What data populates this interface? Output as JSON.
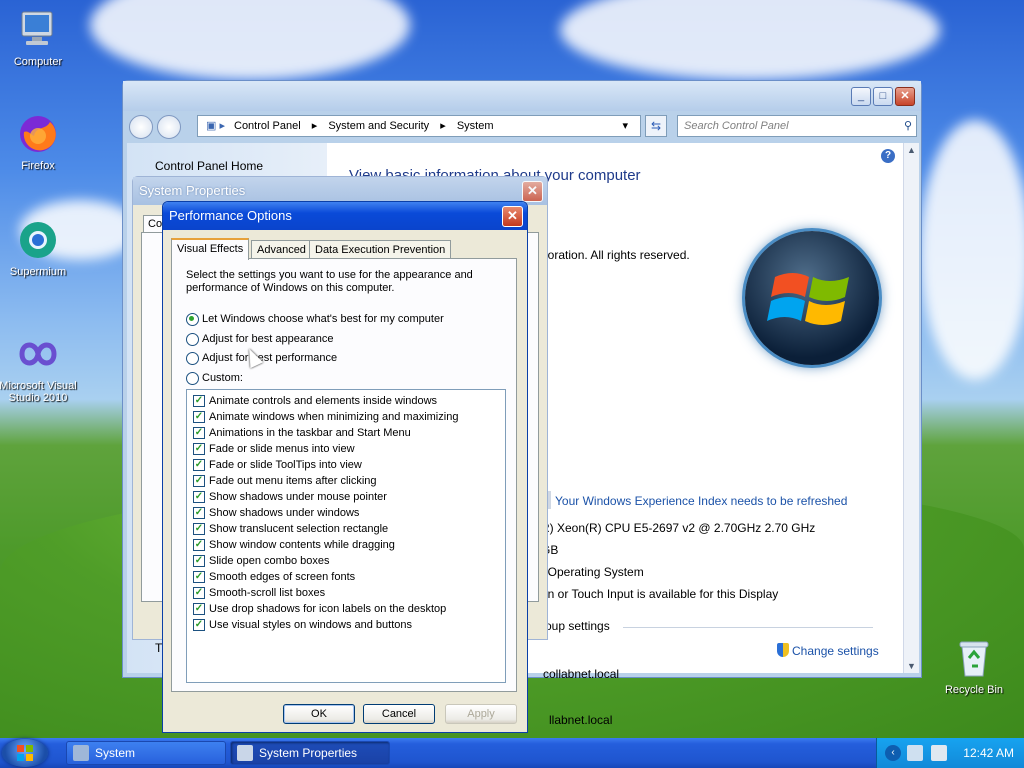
{
  "desktop": {
    "icons": [
      {
        "label": "Computer"
      },
      {
        "label": "Firefox"
      },
      {
        "label": "Supermium"
      },
      {
        "label": "Microsoft Visual Studio 2010"
      },
      {
        "label": "Recycle Bin"
      }
    ]
  },
  "control_panel": {
    "breadcrumb": [
      "Control Panel",
      "System and Security",
      "System"
    ],
    "search_placeholder": "Search Control Panel",
    "left_pane": {
      "home_link": "Control Panel Home"
    },
    "heading": "View basic information about your computer",
    "copyright_fragment": "poration.  All rights reserved.",
    "wei_link": "Your Windows Experience Index needs to be refreshed",
    "processor_fragment": "R) Xeon(R) CPU E5-2697 v2 @ 2.70GHz   2.70 GHz",
    "ram_fragment": "GB",
    "system_type_fragment": "t Operating System",
    "pen_fragment": "en or Touch Input is available for this Display",
    "group_settings_fragment": "roup settings",
    "change_settings_link": "Change settings",
    "domain_fragment_1": "collabnet.local",
    "domain_fragment_2": "llabnet.local"
  },
  "system_properties": {
    "title": "System Properties",
    "tab_fragment": "Co",
    "footer_fragment": "T"
  },
  "performance_options": {
    "title": "Performance Options",
    "tabs": [
      "Visual Effects",
      "Advanced",
      "Data Execution Prevention"
    ],
    "active_tab": "Visual Effects",
    "description": "Select the settings you want to use for the appearance and performance of Windows on this computer.",
    "radios": [
      {
        "label": "Let Windows choose what's best for my computer",
        "selected": true
      },
      {
        "label": "Adjust for best appearance",
        "selected": false
      },
      {
        "label": "Adjust for best performance",
        "selected": false
      },
      {
        "label": "Custom:",
        "selected": false
      }
    ],
    "effects": [
      {
        "label": "Animate controls and elements inside windows",
        "checked": true
      },
      {
        "label": "Animate windows when minimizing and maximizing",
        "checked": true
      },
      {
        "label": "Animations in the taskbar and Start Menu",
        "checked": true
      },
      {
        "label": "Fade or slide menus into view",
        "checked": true
      },
      {
        "label": "Fade or slide ToolTips into view",
        "checked": true
      },
      {
        "label": "Fade out menu items after clicking",
        "checked": true
      },
      {
        "label": "Show shadows under mouse pointer",
        "checked": true
      },
      {
        "label": "Show shadows under windows",
        "checked": true
      },
      {
        "label": "Show translucent selection rectangle",
        "checked": true
      },
      {
        "label": "Show window contents while dragging",
        "checked": true
      },
      {
        "label": "Slide open combo boxes",
        "checked": true
      },
      {
        "label": "Smooth edges of screen fonts",
        "checked": true
      },
      {
        "label": "Smooth-scroll list boxes",
        "checked": true
      },
      {
        "label": "Use drop shadows for icon labels on the desktop",
        "checked": true
      },
      {
        "label": "Use visual styles on windows and buttons",
        "checked": true
      }
    ],
    "buttons": {
      "ok": "OK",
      "cancel": "Cancel",
      "apply": "Apply"
    }
  },
  "taskbar": {
    "items": [
      {
        "label": "System",
        "active": false
      },
      {
        "label": "System Properties",
        "active": true
      }
    ],
    "clock": "12:42 AM"
  },
  "colors": {
    "xp_titlebar": "#0a4ad8",
    "link": "#1b52a8",
    "heading": "#1e3a8a",
    "radio_dot": "#2ea32e"
  }
}
